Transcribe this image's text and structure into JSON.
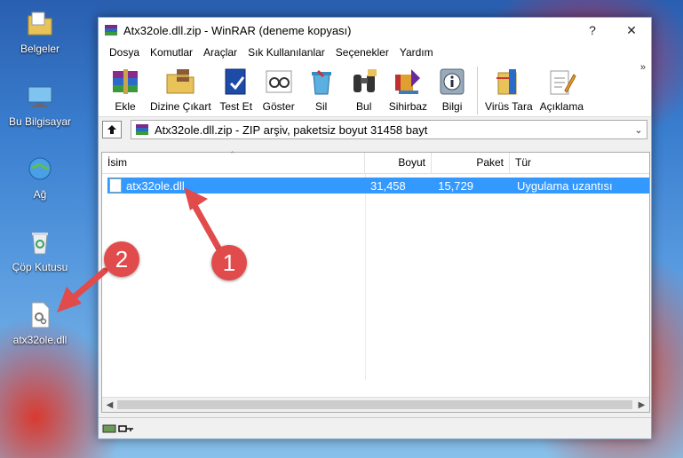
{
  "desktop": {
    "icons": [
      {
        "label": "Belgeler"
      },
      {
        "label": "Bu Bilgisayar"
      },
      {
        "label": "Ağ"
      },
      {
        "label": "Çöp Kutusu"
      },
      {
        "label": "atx32ole.dll"
      }
    ]
  },
  "window": {
    "title": "Atx32ole.dll.zip - WinRAR (deneme kopyası)",
    "help": "?",
    "close": "✕"
  },
  "menu": [
    "Dosya",
    "Komutlar",
    "Araçlar",
    "Sık Kullanılanlar",
    "Seçenekler",
    "Yardım"
  ],
  "toolbar": {
    "items": [
      "Ekle",
      "Dizine Çıkart",
      "Test Et",
      "Göster",
      "Sil",
      "Bul",
      "Sihirbaz",
      "Bilgi",
      "Virüs Tara",
      "Açıklama"
    ],
    "more": "»"
  },
  "address": {
    "text": "Atx32ole.dll.zip - ZIP arşiv, paketsiz boyut 31458 bayt"
  },
  "table": {
    "headers": [
      "İsim",
      "Boyut",
      "Paket",
      "Tür"
    ],
    "rows": [
      {
        "name": "atx32ole.dll",
        "size": "31,458",
        "packed": "15,729",
        "type": "Uygulama uzantısı"
      }
    ]
  },
  "callouts": [
    "1",
    "2"
  ],
  "colors": {
    "selection": "#3399ff",
    "callout": "#e14b4b"
  }
}
